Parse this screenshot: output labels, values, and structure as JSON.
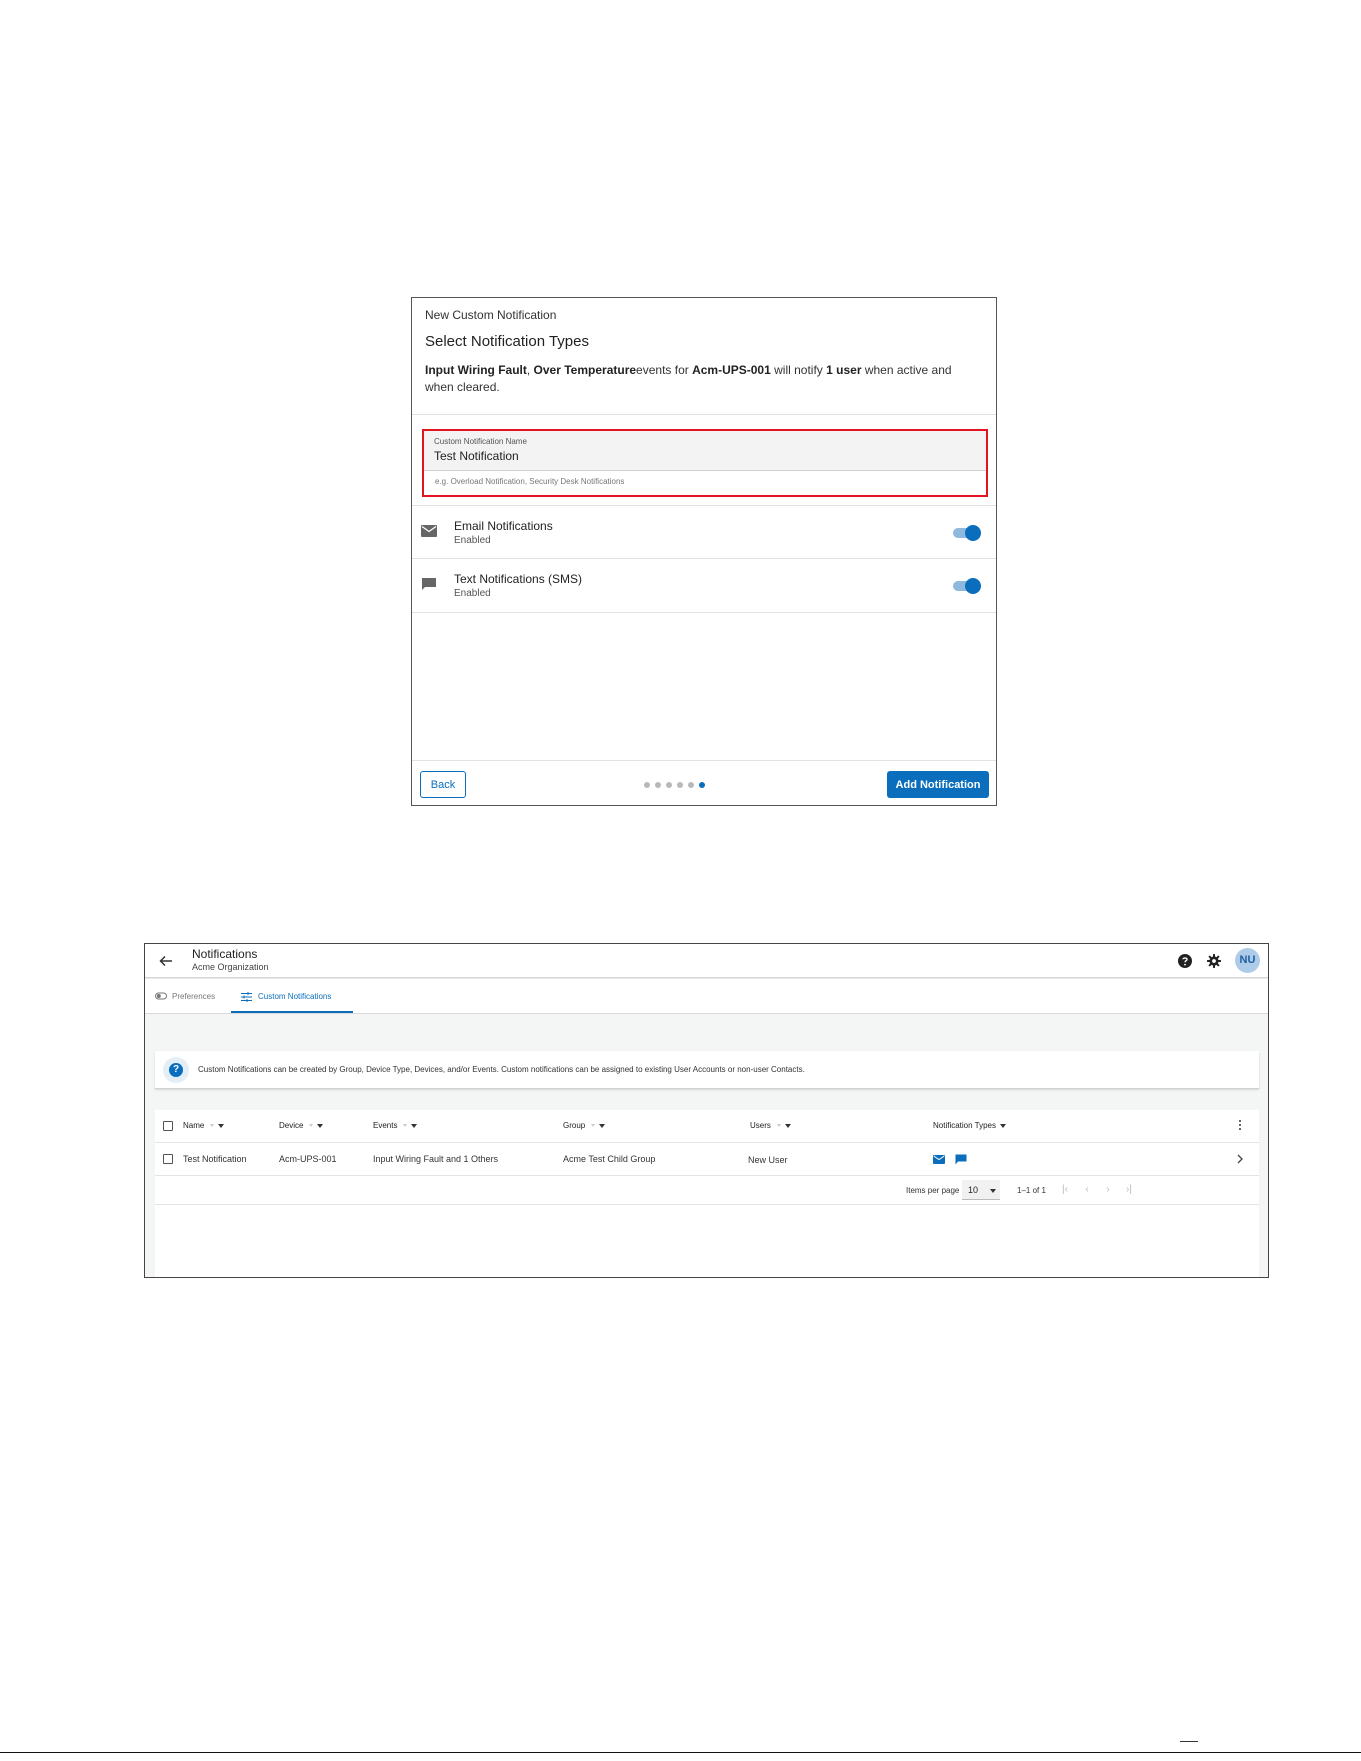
{
  "dialog": {
    "subtitle": "New Custom Notification",
    "title": "Select Notification Types",
    "summary": {
      "events_bold": "Input Wiring Fault",
      "sep": ", ",
      "events_bold_2": "Over Temperature",
      "text_1": "events for ",
      "device_bold": "Acm-UPS-001",
      "text_2": " will notify ",
      "users_bold": "1 user",
      "text_3": " when active and when cleared."
    },
    "name_field": {
      "label": "Custom Notification Name",
      "value": "Test Notification",
      "hint": "e.g. Overload Notification, Security Desk Notifications"
    },
    "toggles": [
      {
        "title": "Email Notifications",
        "status": "Enabled",
        "icon": "mail-icon",
        "on": true
      },
      {
        "title": "Text Notifications (SMS)",
        "status": "Enabled",
        "icon": "chat-icon",
        "on": true
      }
    ],
    "footer": {
      "back_label": "Back",
      "add_label": "Add Notification",
      "step_count": 6,
      "active_step": 6
    },
    "highlight_color": "#e2141f"
  },
  "page": {
    "title": "Notifications",
    "organization": "Acme Organization",
    "avatar_initials": "NU",
    "tabs": [
      {
        "label": "Preferences",
        "icon": "toggle-icon",
        "active": false
      },
      {
        "label": "Custom Notifications",
        "icon": "sliders-icon",
        "active": true
      }
    ],
    "info_text": "Custom Notifications can be created by Group, Device Type, Devices, and/or Events. Custom notifications can be assigned to existing User Accounts or non-user Contacts.",
    "table": {
      "columns": [
        "Name",
        "Device",
        "Events",
        "Group",
        "Users",
        "Notification Types"
      ],
      "rows": [
        {
          "name": "Test Notification",
          "device": "Acm-UPS-001",
          "events": "Input Wiring Fault and 1 Others",
          "group": "Acme Test Child Group",
          "users": "New User",
          "types": [
            "mail-icon",
            "chat-icon"
          ]
        }
      ]
    },
    "pager": {
      "items_per_page_label": "Items per page",
      "items_per_page": "10",
      "range": "1–1 of 1"
    },
    "accent_color": "#0a6ebd"
  }
}
